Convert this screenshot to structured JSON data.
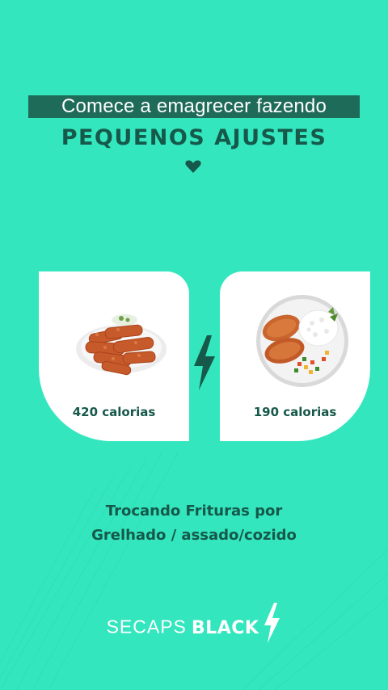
{
  "header": {
    "line1": "Comece a emagrecer fazendo",
    "line2": "PEQUENOS AJUSTES"
  },
  "cards": [
    {
      "calories": "420 calorias",
      "image": "fried-food-plate"
    },
    {
      "calories": "190 calorias",
      "image": "grilled-chicken-plate"
    }
  ],
  "caption": {
    "line1": "Trocando Frituras por",
    "line2": "Grelhado / assado/cozido"
  },
  "brand": {
    "light": "SECAPS",
    "bold": "BLACK"
  },
  "colors": {
    "background": "#33e6be",
    "dark_green": "#16584a",
    "headline_box": "#1f6b5a",
    "card": "#ffffff"
  },
  "icons": {
    "heart": "heart-icon",
    "bolt": "lightning-bolt-icon"
  }
}
